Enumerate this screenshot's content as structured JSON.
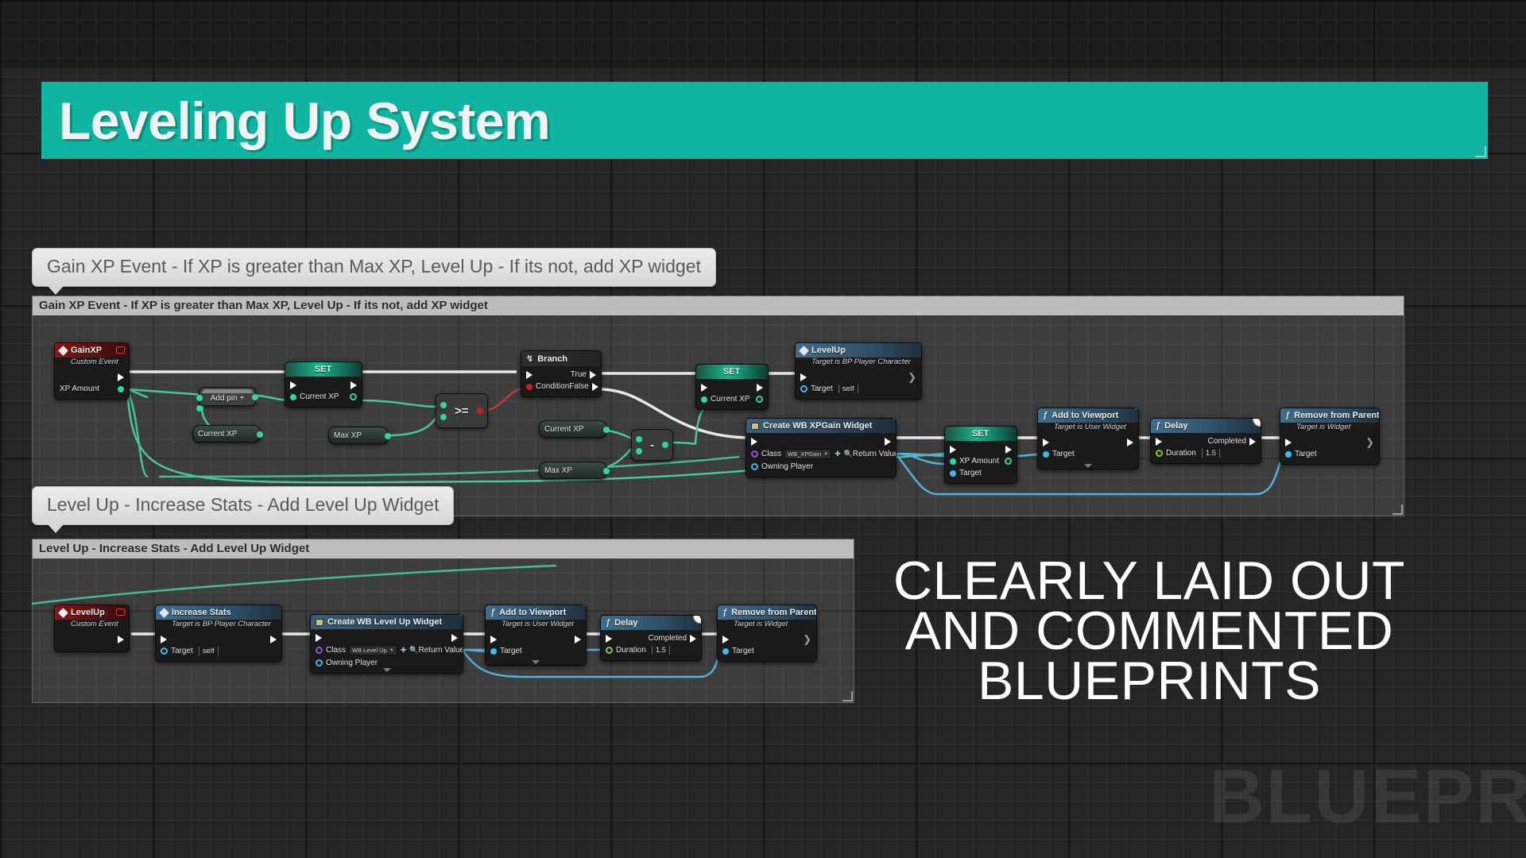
{
  "title_banner": {
    "text": "Leveling Up System",
    "color": "#0fb5a0"
  },
  "promo": {
    "line1": "CLEARLY LAID OUT",
    "line2": "AND COMMENTED",
    "line3": "BLUEPRINTS",
    "watermark": "BLUEPR"
  },
  "callouts": {
    "gain_xp": "Gain XP Event - If XP is greater than Max XP, Level Up - If its not, add XP widget",
    "level_up": "Level Up - Increase Stats - Add Level Up Widget"
  },
  "comments": {
    "gain_xp_header": "Gain XP Event - If XP is greater than Max XP, Level Up - If its not, add XP widget",
    "level_up_header": "Level Up - Increase Stats - Add Level Up Widget"
  },
  "graph1": {
    "event_gainxp": {
      "title": "GainXP",
      "subtitle": "Custom Event",
      "out_pin": "XP Amount"
    },
    "addpin": {
      "label": "Add pin",
      "symbol": "+"
    },
    "var_current_xp_1": {
      "label": "Current XP"
    },
    "set_current_xp_1": {
      "title": "SET",
      "pin": "Current XP"
    },
    "var_max_xp_1": {
      "label": "Max XP"
    },
    "compare_gte": {
      "symbol": ">="
    },
    "branch": {
      "title": "Branch",
      "condition": "Condition",
      "true_label": "True",
      "false_label": "False"
    },
    "set_current_xp_2": {
      "title": "SET",
      "pin": "Current XP"
    },
    "levelup_call": {
      "title": "LevelUp",
      "subtitle": "Target is BP Player Character",
      "target": "Target",
      "target_value": "self"
    },
    "var_current_xp_2": {
      "label": "Current XP"
    },
    "var_max_xp_2": {
      "label": "Max XP"
    },
    "subtract": {
      "symbol": "-"
    },
    "create_xpgain": {
      "title": "Create WB XPGain Widget",
      "class_label": "Class",
      "class_value": "WB_XPGain",
      "owning_player": "Owning Player",
      "return_value": "Return Value"
    },
    "set_xp_amount": {
      "title": "SET",
      "pin1": "XP Amount",
      "pin2": "Target"
    },
    "add_to_viewport": {
      "title": "Add to Viewport",
      "subtitle": "Target is User Widget",
      "target": "Target"
    },
    "delay": {
      "title": "Delay",
      "duration_label": "Duration",
      "duration_value": "1.5",
      "completed": "Completed",
      "latent_badge": "t"
    },
    "remove_parent": {
      "title": "Remove from Parent",
      "subtitle": "Target is Widget",
      "target": "Target"
    }
  },
  "graph2": {
    "event_levelup": {
      "title": "LevelUp",
      "subtitle": "Custom Event"
    },
    "increase_stats": {
      "title": "Increase Stats",
      "subtitle": "Target is BP Player Character",
      "target": "Target",
      "target_value": "self"
    },
    "create_levelup": {
      "title": "Create WB Level Up Widget",
      "class_label": "Class",
      "class_value": "WB Level Up",
      "owning_player": "Owning Player",
      "return_value": "Return Value"
    },
    "add_to_viewport": {
      "title": "Add to Viewport",
      "subtitle": "Target is User Widget",
      "target": "Target"
    },
    "delay": {
      "title": "Delay",
      "duration_label": "Duration",
      "duration_value": "1.5",
      "completed": "Completed",
      "latent_badge": "t"
    },
    "remove_parent": {
      "title": "Remove from Parent",
      "subtitle": "Target is Widget",
      "target": "Target"
    }
  },
  "colors": {
    "exec_wire": "#ffffff",
    "float_wire": "#2fd6a4",
    "object_wire": "#3fb8f0",
    "bool_wire": "#cc2020",
    "accent": "#0fb5a0"
  }
}
